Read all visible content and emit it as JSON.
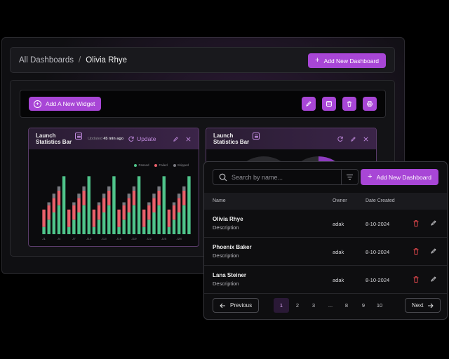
{
  "header": {
    "crumb_root": "All Dashboards",
    "crumb_sep": "/",
    "crumb_current": "Olivia Rhye",
    "add_button": "Add New Dashboard"
  },
  "toolbar": {
    "add_widget": "Add A New Widget",
    "tools": [
      "pencil-icon",
      "palette-icon",
      "trash-icon",
      "printer-icon"
    ]
  },
  "widget": {
    "title": "Launch Statistics Bar",
    "updated_prefix": "Updated",
    "updated_time": "45 min ago",
    "update_label": "Update",
    "legend": [
      {
        "label": "Passed",
        "color": "#4fc48a"
      },
      {
        "label": "Failed",
        "color": "#e9606a"
      },
      {
        "label": "Skipped",
        "color": "#7a7a80"
      }
    ]
  },
  "chart_data": {
    "type": "bar",
    "stacked": true,
    "categories": [
      "J1",
      "J2",
      "J3",
      "J4",
      "J5",
      "J6",
      "J7",
      "J8",
      "J9",
      "J10",
      "J11",
      "J12",
      "J13",
      "J14",
      "J15",
      "J16",
      "J17",
      "J18",
      "J19",
      "J20",
      "J21",
      "J22",
      "J23",
      "J24",
      "J25",
      "J26",
      "J27",
      "J28",
      "J29"
    ],
    "series": [
      {
        "name": "Passed",
        "values": [
          5,
          10,
          15,
          20,
          40,
          5,
          10,
          15,
          20,
          40,
          5,
          10,
          15,
          20,
          40,
          5,
          10,
          15,
          20,
          40,
          5,
          10,
          15,
          20,
          40,
          5,
          10,
          15,
          20,
          40
        ]
      },
      {
        "name": "Failed",
        "values": [
          12,
          10,
          10,
          10,
          0,
          12,
          10,
          10,
          10,
          0,
          12,
          10,
          10,
          10,
          0,
          12,
          10,
          10,
          10,
          0,
          12,
          10,
          10,
          10,
          0,
          12,
          10,
          10,
          10,
          0
        ]
      },
      {
        "name": "Skipped",
        "values": [
          0,
          2,
          3,
          3,
          0,
          0,
          2,
          3,
          3,
          0,
          0,
          2,
          3,
          3,
          0,
          0,
          2,
          3,
          3,
          0,
          0,
          2,
          3,
          3,
          0,
          0,
          2,
          3,
          3,
          0
        ]
      }
    ],
    "xlabel": "",
    "ylabel": "",
    "ylim": [
      0,
      45
    ]
  },
  "widget2": {
    "title": "Launch Statistics Bar"
  },
  "table": {
    "search_placeholder": "Search by name...",
    "add_button": "Add New Dashboard",
    "columns": [
      "Name",
      "Owner",
      "Date Created"
    ],
    "rows": [
      {
        "name": "Olivia Rhye",
        "desc": "Description",
        "owner": "adak",
        "date": "8-10-2024"
      },
      {
        "name": "Phoenix Baker",
        "desc": "Description",
        "owner": "adak",
        "date": "8-10-2024"
      },
      {
        "name": "Lana Steiner",
        "desc": "Description",
        "owner": "adak",
        "date": "8-10-2024"
      }
    ],
    "prev": "Previous",
    "next": "Next",
    "pages": [
      "1",
      "2",
      "3",
      "...",
      "8",
      "9",
      "10"
    ]
  }
}
